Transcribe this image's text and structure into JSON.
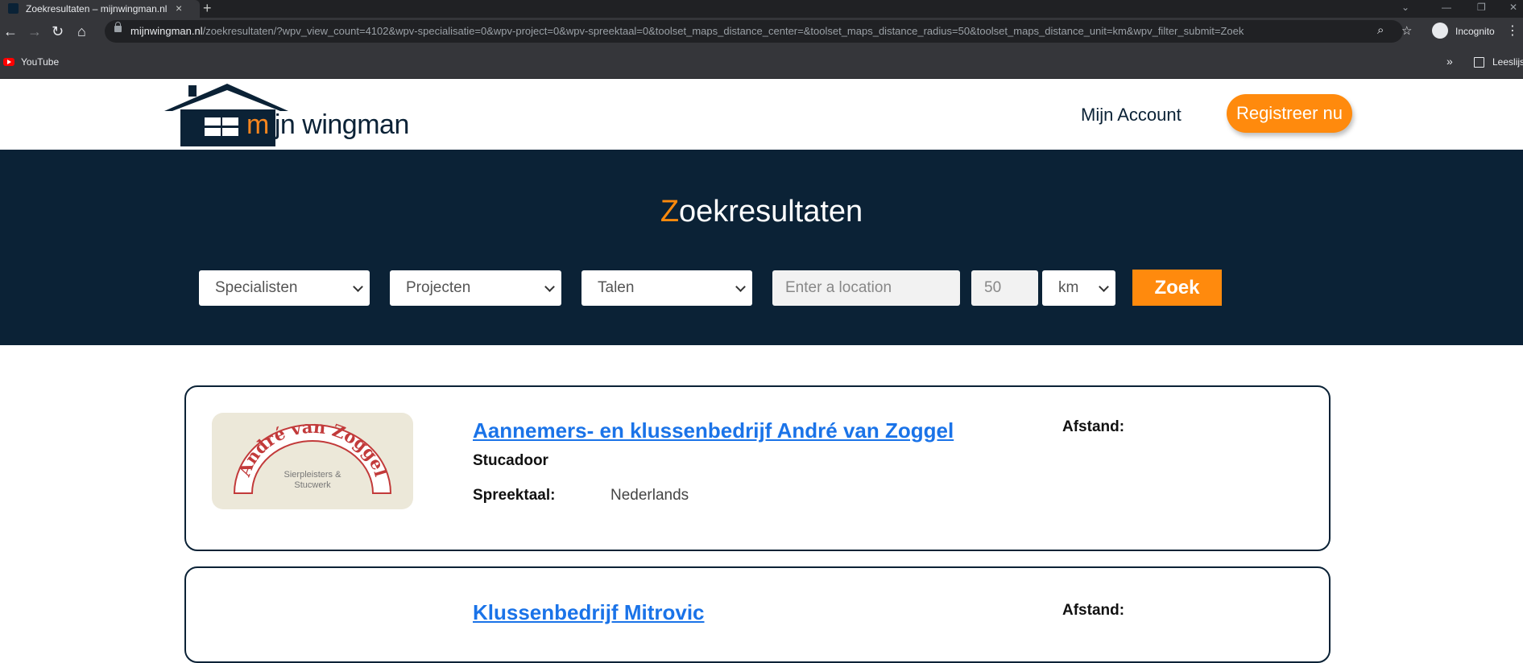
{
  "browser": {
    "tab_title": "Zoekresultaten – mijnwingman.nl",
    "url_domain": "mijnwingman.nl",
    "url_path": "/zoekresultaten/?wpv_view_count=4102&wpv-specialisatie=0&wpv-project=0&wpv-spreektaal=0&toolset_maps_distance_center=&toolset_maps_distance_radius=50&toolset_maps_distance_unit=km&wpv_filter_submit=Zoek",
    "incognito_label": "Incognito",
    "bookmarks": [
      {
        "label": "YouTube",
        "icon": "youtube-icon"
      }
    ],
    "reading_list_label": "Leeslijst"
  },
  "header": {
    "logo_text_m": "m",
    "logo_text_rest": "ijn wingman",
    "account_label": "Mijn Account",
    "register_label": "Registreer nu"
  },
  "hero": {
    "title_first": "Z",
    "title_rest": "oekresultaten",
    "filters": {
      "specialisten": "Specialisten",
      "projecten": "Projecten",
      "talen": "Talen",
      "location_placeholder": "Enter a location",
      "radius_value": "50",
      "unit": "km"
    },
    "search_label": "Zoek"
  },
  "results": [
    {
      "company": "Aannemers- en klussenbedrijf André van Zoggel",
      "specialty": "Stucadoor",
      "language_label": "Spreektaal:",
      "language": "Nederlands",
      "distance_label": "Afstand:",
      "logo_text_main": "André van Zoggel",
      "logo_text_sub1": "Sierpleisters &",
      "logo_text_sub2": "Stucwerk"
    },
    {
      "company": "Klussenbedrijf Mitrovic",
      "distance_label": "Afstand:"
    }
  ],
  "colors": {
    "brand_navy": "#0b2236",
    "brand_orange": "#ff8a0d",
    "link_blue": "#1a73e8"
  }
}
